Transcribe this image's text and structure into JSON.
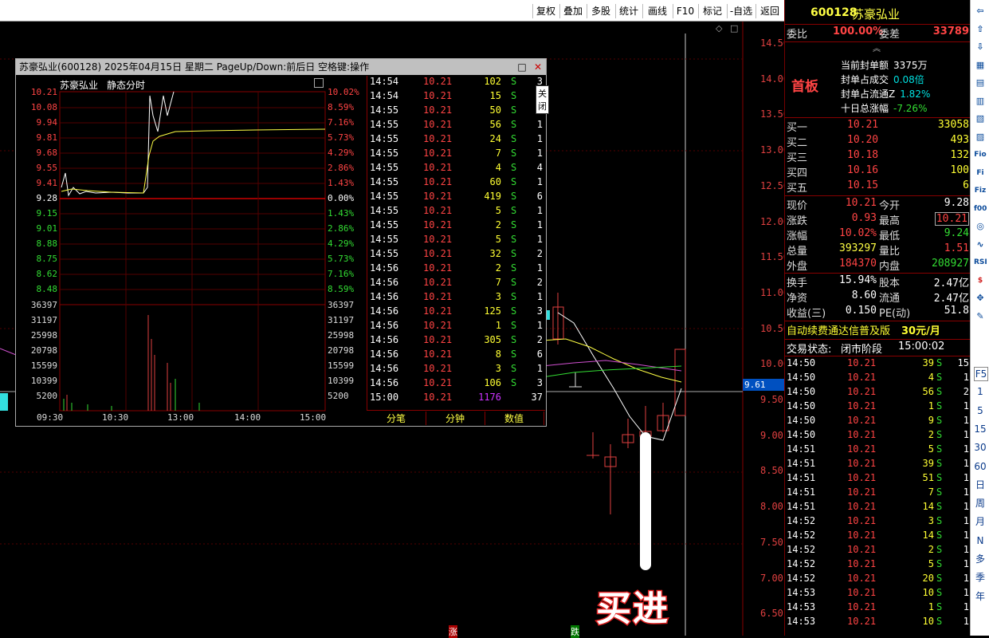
{
  "toolbar": {
    "buttons": [
      "复权",
      "叠加",
      "多股",
      "统计",
      "画线",
      "F10",
      "标记",
      "-自选",
      "返回"
    ]
  },
  "main_chart": {
    "price_ticks": [
      "14.50",
      "14.00",
      "13.50",
      "13.00",
      "12.50",
      "12.00",
      "11.50",
      "11.00",
      "10.50",
      "10.00",
      "9.50",
      "9.00",
      "8.50",
      "8.00",
      "7.50",
      "7.00",
      "6.50"
    ],
    "current_price_label": "9.61",
    "annotation": "买进",
    "bottom_marks": [
      "涨",
      "跌"
    ]
  },
  "popup": {
    "title": "苏豪弘业(600128) 2025年04月15日 星期二 PageUp/Down:前后日 空格键:操作",
    "close_tooltip": "关闭",
    "chart_title": "苏豪弘业",
    "chart_subtitle": "静态分时",
    "price_labels": [
      "10.21",
      "10.08",
      "9.94",
      "9.81",
      "9.68",
      "9.55",
      "9.41",
      "9.28",
      "9.15",
      "9.01",
      "8.88",
      "8.75",
      "8.62",
      "8.48"
    ],
    "pct_labels": [
      "10.02%",
      "8.59%",
      "7.16%",
      "5.73%",
      "4.29%",
      "2.86%",
      "1.43%",
      "0.00%",
      "1.43%",
      "2.86%",
      "4.29%",
      "5.73%",
      "7.16%",
      "8.59%"
    ],
    "vol_labels": [
      "36397",
      "31197",
      "25998",
      "20798",
      "15599",
      "10399",
      "5200"
    ],
    "time_labels": [
      "09:30",
      "10:30",
      "13:00",
      "14:00",
      "15:00"
    ],
    "ticks": [
      {
        "time": "14:54",
        "price": "10.21",
        "vol": "102",
        "side": "S",
        "n": "3"
      },
      {
        "time": "14:54",
        "price": "10.21",
        "vol": "15",
        "side": "S",
        "n": "1"
      },
      {
        "time": "14:55",
        "price": "10.21",
        "vol": "50",
        "side": "S",
        "n": "2"
      },
      {
        "time": "14:55",
        "price": "10.21",
        "vol": "56",
        "side": "S",
        "n": "1"
      },
      {
        "time": "14:55",
        "price": "10.21",
        "vol": "24",
        "side": "S",
        "n": "1"
      },
      {
        "time": "14:55",
        "price": "10.21",
        "vol": "7",
        "side": "S",
        "n": "1"
      },
      {
        "time": "14:55",
        "price": "10.21",
        "vol": "4",
        "side": "S",
        "n": "4"
      },
      {
        "time": "14:55",
        "price": "10.21",
        "vol": "60",
        "side": "S",
        "n": "1"
      },
      {
        "time": "14:55",
        "price": "10.21",
        "vol": "419",
        "side": "S",
        "n": "6"
      },
      {
        "time": "14:55",
        "price": "10.21",
        "vol": "5",
        "side": "S",
        "n": "1"
      },
      {
        "time": "14:55",
        "price": "10.21",
        "vol": "2",
        "side": "S",
        "n": "1"
      },
      {
        "time": "14:55",
        "price": "10.21",
        "vol": "5",
        "side": "S",
        "n": "1"
      },
      {
        "time": "14:55",
        "price": "10.21",
        "vol": "32",
        "side": "S",
        "n": "2"
      },
      {
        "time": "14:56",
        "price": "10.21",
        "vol": "2",
        "side": "S",
        "n": "1"
      },
      {
        "time": "14:56",
        "price": "10.21",
        "vol": "7",
        "side": "S",
        "n": "2"
      },
      {
        "time": "14:56",
        "price": "10.21",
        "vol": "3",
        "side": "S",
        "n": "1"
      },
      {
        "time": "14:56",
        "price": "10.21",
        "vol": "125",
        "side": "S",
        "n": "3"
      },
      {
        "time": "14:56",
        "price": "10.21",
        "vol": "1",
        "side": "S",
        "n": "1"
      },
      {
        "time": "14:56",
        "price": "10.21",
        "vol": "305",
        "side": "S",
        "n": "2"
      },
      {
        "time": "14:56",
        "price": "10.21",
        "vol": "8",
        "side": "S",
        "n": "6"
      },
      {
        "time": "14:56",
        "price": "10.21",
        "vol": "3",
        "side": "S",
        "n": "1"
      },
      {
        "time": "14:56",
        "price": "10.21",
        "vol": "106",
        "side": "S",
        "n": "3"
      },
      {
        "time": "15:00",
        "price": "10.21",
        "vol": "1176",
        "side": "",
        "n": "37"
      }
    ],
    "tabs": [
      "分笔",
      "分钟",
      "数值"
    ]
  },
  "right_panel": {
    "code": "600128",
    "name": "苏豪弘业",
    "weibi_label": "委比",
    "weibi_value": "100.00%",
    "weicha_label": "委差",
    "weicha_value": "33789",
    "board_label": "首板",
    "fengdan": [
      {
        "label": "当前封单额",
        "value": "3375万"
      },
      {
        "label": "封单占成交",
        "value": "0.08倍"
      },
      {
        "label": "封单占流通Z",
        "value": "1.82%"
      },
      {
        "label": "十日总涨幅",
        "value": "-7.26%"
      }
    ],
    "bids": [
      {
        "label": "买一",
        "price": "10.21",
        "vol": "33058"
      },
      {
        "label": "买二",
        "price": "10.20",
        "vol": "493"
      },
      {
        "label": "买三",
        "price": "10.18",
        "vol": "132"
      },
      {
        "label": "买四",
        "price": "10.16",
        "vol": "100"
      },
      {
        "label": "买五",
        "price": "10.15",
        "vol": "6"
      }
    ],
    "quote": [
      {
        "l1": "现价",
        "v1": "10.21",
        "l2": "今开",
        "v2": "9.28"
      },
      {
        "l1": "涨跌",
        "v1": "0.93",
        "l2": "最高",
        "v2": "10.21"
      },
      {
        "l1": "涨幅",
        "v1": "10.02%",
        "l2": "最低",
        "v2": "9.24"
      },
      {
        "l1": "总量",
        "v1": "393297",
        "l2": "量比",
        "v2": "1.51"
      },
      {
        "l1": "外盘",
        "v1": "184370",
        "l2": "内盘",
        "v2": "208927"
      }
    ],
    "quote2": [
      {
        "l1": "换手",
        "v1": "15.94%",
        "l2": "股本",
        "v2": "2.47亿"
      },
      {
        "l1": "净资",
        "v1": "8.60",
        "l2": "流通",
        "v2": "2.47亿"
      },
      {
        "l1": "收益(三)",
        "v1": "0.150",
        "l2": "PE(动)",
        "v2": "51.8"
      }
    ],
    "ad_text": "自动续费通达信普及版",
    "ad_price": "30元/月",
    "status_label": "交易状态:",
    "status_value": "闭市阶段",
    "status_time": "15:00:02",
    "trades": [
      {
        "time": "14:50",
        "price": "10.21",
        "vol": "39",
        "side": "S",
        "n": "15"
      },
      {
        "time": "14:50",
        "price": "10.21",
        "vol": "4",
        "side": "S",
        "n": "1"
      },
      {
        "time": "14:50",
        "price": "10.21",
        "vol": "56",
        "side": "S",
        "n": "2"
      },
      {
        "time": "14:50",
        "price": "10.21",
        "vol": "1",
        "side": "S",
        "n": "1"
      },
      {
        "time": "14:50",
        "price": "10.21",
        "vol": "9",
        "side": "S",
        "n": "1"
      },
      {
        "time": "14:50",
        "price": "10.21",
        "vol": "2",
        "side": "S",
        "n": "1"
      },
      {
        "time": "14:51",
        "price": "10.21",
        "vol": "5",
        "side": "S",
        "n": "1"
      },
      {
        "time": "14:51",
        "price": "10.21",
        "vol": "39",
        "side": "S",
        "n": "1"
      },
      {
        "time": "14:51",
        "price": "10.21",
        "vol": "51",
        "side": "S",
        "n": "1"
      },
      {
        "time": "14:51",
        "price": "10.21",
        "vol": "7",
        "side": "S",
        "n": "1"
      },
      {
        "time": "14:51",
        "price": "10.21",
        "vol": "14",
        "side": "S",
        "n": "1"
      },
      {
        "time": "14:52",
        "price": "10.21",
        "vol": "3",
        "side": "S",
        "n": "1"
      },
      {
        "time": "14:52",
        "price": "10.21",
        "vol": "14",
        "side": "S",
        "n": "1"
      },
      {
        "time": "14:52",
        "price": "10.21",
        "vol": "2",
        "side": "S",
        "n": "1"
      },
      {
        "time": "14:52",
        "price": "10.21",
        "vol": "5",
        "side": "S",
        "n": "1"
      },
      {
        "time": "14:52",
        "price": "10.21",
        "vol": "20",
        "side": "S",
        "n": "1"
      },
      {
        "time": "14:53",
        "price": "10.21",
        "vol": "10",
        "side": "S",
        "n": "1"
      },
      {
        "time": "14:53",
        "price": "10.21",
        "vol": "1",
        "side": "S",
        "n": "1"
      },
      {
        "time": "14:53",
        "price": "10.21",
        "vol": "10",
        "side": "S",
        "n": "1"
      }
    ]
  },
  "sidebar": {
    "icons": [
      "arrow-left-icon",
      "arrow-up-icon",
      "arrow-down-icon",
      "chart-icon",
      "grid-icon",
      "list-icon",
      "bar-icon",
      "table-icon",
      "fio-icon",
      "fi-icon",
      "fiz-icon",
      "f00-icon",
      "circle-icon",
      "wave-icon",
      "rsi-icon",
      "dollar-icon",
      "move-icon",
      "pen-icon"
    ],
    "icon_labels": [
      "",
      "",
      "",
      "",
      "",
      "",
      "",
      "",
      "Fio",
      "Fi",
      "Fiz",
      "f00",
      "",
      "",
      "RSI",
      "$",
      "",
      ""
    ],
    "periods": [
      "F5",
      "1",
      "5",
      "15",
      "30",
      "60",
      "日",
      "周",
      "月",
      "N",
      "多",
      "季",
      "年"
    ]
  }
}
